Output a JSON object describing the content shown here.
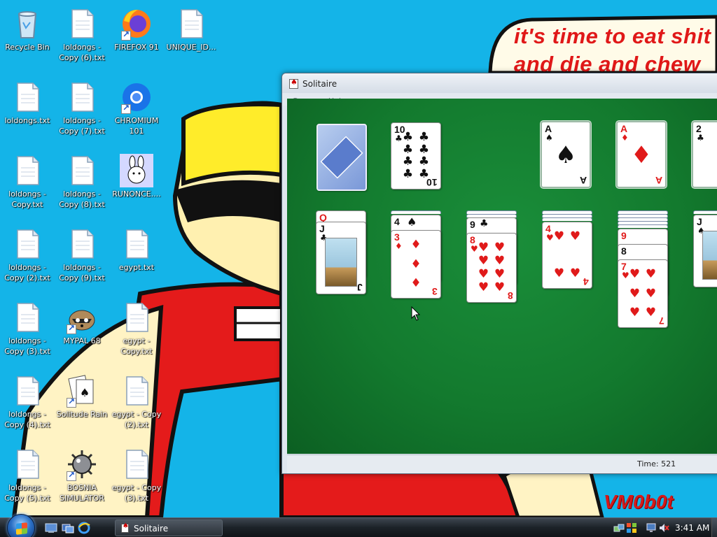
{
  "wallpaper": {
    "line1": "it's time to eat shit",
    "line2": "and die and chew",
    "signature": "VM0b0t"
  },
  "desktop_icons": [
    {
      "label": "Recycle Bin",
      "icon": "recycle-bin-icon"
    },
    {
      "label": "loldongs - Copy (6).txt",
      "icon": "text-file-icon"
    },
    {
      "label": "FIREFOX 91",
      "icon": "firefox-icon"
    },
    {
      "label": "UNIQUE_ID...",
      "icon": "text-file-icon"
    },
    {
      "label": "loldongs.txt",
      "icon": "text-file-icon"
    },
    {
      "label": "loldongs - Copy (7).txt",
      "icon": "text-file-icon"
    },
    {
      "label": "CHROMIUM 101",
      "icon": "chromium-icon"
    },
    {
      "label": "loldongs - Copy.txt",
      "icon": "text-file-icon"
    },
    {
      "label": "loldongs - Copy (8).txt",
      "icon": "text-file-icon"
    },
    {
      "label": "RUNONCE....",
      "icon": "bunny-icon"
    },
    {
      "label": "loldongs - Copy (2).txt",
      "icon": "text-file-icon"
    },
    {
      "label": "loldongs - Copy (9).txt",
      "icon": "text-file-icon"
    },
    {
      "label": "egypt.txt",
      "icon": "text-file-icon"
    },
    {
      "label": "loldongs - Copy (3).txt",
      "icon": "text-file-icon"
    },
    {
      "label": "MYPAL 68",
      "icon": "raccoon-icon"
    },
    {
      "label": "egypt - Copy.txt",
      "icon": "text-file-icon"
    },
    {
      "label": "loldongs - Copy (4).txt",
      "icon": "text-file-icon"
    },
    {
      "label": "Solitude Rain",
      "icon": "cards-icon"
    },
    {
      "label": "egypt - Copy (2).txt",
      "icon": "text-file-icon"
    },
    {
      "label": "loldongs - Copy (5).txt",
      "icon": "text-file-icon"
    },
    {
      "label": "BOSNIA SIMULATOR",
      "icon": "mine-icon"
    },
    {
      "label": "egypt - Copy (3).txt",
      "icon": "text-file-icon"
    }
  ],
  "solitaire": {
    "title": "Solitaire",
    "menu": [
      "Game",
      "Help"
    ],
    "time_label": "Time:  521",
    "waste_card": {
      "rank": "10",
      "suit": "♣"
    },
    "foundations": [
      {
        "rank": "A",
        "suit": "♠"
      },
      {
        "rank": "A",
        "suit": "♦"
      },
      {
        "rank": "2",
        "suit": "♣"
      }
    ],
    "tableau": [
      {
        "top_ranks": [
          "Q",
          "J"
        ],
        "top_suits": [
          "♥",
          "♣"
        ]
      },
      {
        "top_ranks": [
          "4",
          "3"
        ],
        "top_suits": [
          "♠",
          "♦"
        ]
      },
      {
        "top_ranks": [
          "9",
          "8"
        ],
        "top_suits": [
          "♣",
          "♥"
        ]
      },
      {
        "top_ranks": [
          "4"
        ],
        "top_suits": [
          "♥"
        ]
      },
      {
        "top_ranks": [
          "9",
          "8",
          "7"
        ],
        "top_suits": [
          "♥",
          "♣",
          "♥"
        ]
      },
      {
        "top_ranks": [
          "J"
        ],
        "top_suits": [
          "♠"
        ]
      }
    ]
  },
  "taskbar": {
    "active_task": "Solitaire",
    "clock": "3:41 AM"
  }
}
